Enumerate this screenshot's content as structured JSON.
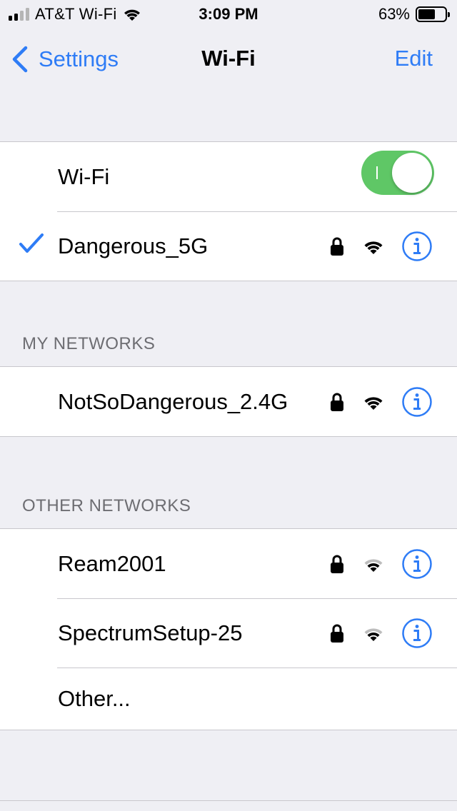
{
  "status_bar": {
    "carrier": "AT&T Wi-Fi",
    "time": "3:09 PM",
    "battery_percent": "63%",
    "battery_level": 0.63
  },
  "nav": {
    "back_label": "Settings",
    "title": "Wi-Fi",
    "edit_label": "Edit"
  },
  "wifi_toggle": {
    "label": "Wi-Fi",
    "on": true
  },
  "connected_network": {
    "name": "Dangerous_5G",
    "signal": "strong",
    "locked": true
  },
  "my_networks": {
    "header": "MY NETWORKS",
    "items": [
      {
        "name": "NotSoDangerous_2.4G",
        "signal": "strong",
        "locked": true
      }
    ]
  },
  "other_networks": {
    "header": "OTHER NETWORKS",
    "items": [
      {
        "name": "Ream2001",
        "signal": "medium",
        "locked": true
      },
      {
        "name": "SpectrumSetup-25",
        "signal": "medium",
        "locked": true
      }
    ],
    "other_label": "Other..."
  },
  "colors": {
    "accent": "#2E7CF6",
    "toggle_on": "#5FC766",
    "background": "#EFEFF4",
    "separator": "#C8C7CC",
    "section_text": "#6D6D72"
  },
  "icons": {
    "back": "chevron-left-icon",
    "check": "checkmark-icon",
    "lock": "lock-icon",
    "wifi": "wifi-icon",
    "info": "info-icon"
  }
}
